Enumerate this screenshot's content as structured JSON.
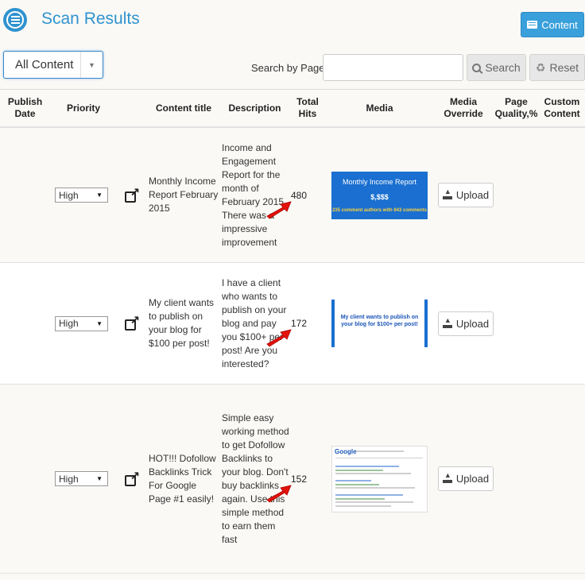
{
  "header": {
    "title": "Scan Results",
    "content_button": "Content"
  },
  "filters": {
    "content_select": "All Content",
    "search_label": "Search by Page",
    "search_value": "",
    "search_button": "Search",
    "reset_button": "Reset"
  },
  "table": {
    "headers": {
      "publish_date": "Publish Date",
      "priority": "Priority",
      "content_title": "Content title",
      "description": "Description",
      "total_hits": "Total Hits",
      "media": "Media",
      "media_override": "Media Override",
      "page_quality": "Page Quality,%",
      "custom_content": "Custom Content"
    },
    "upload_label": "Upload",
    "rows": [
      {
        "publish_date": "",
        "priority": "High",
        "title": "Monthly Income Report February 2015",
        "description": "Income and Engagement Report for the month of February 2015. There was a impressive improvement",
        "hits": "480",
        "media": {
          "line1": "Monthly Income Report",
          "line2": "$,$$$",
          "line3": "235 comment authors with 643 comments"
        }
      },
      {
        "publish_date": "",
        "priority": "High",
        "title": "My client wants to publish on your blog for $100 per post!",
        "description": "I have a client who wants to publish on your blog and pay you $100+ per post! Are you interested?",
        "hits": "172",
        "media": {
          "line1": "My client wants to publish on your blog for $100+ per post!"
        }
      },
      {
        "publish_date": "",
        "priority": "High",
        "title": "HOT!!! Dofollow Backlinks Trick For Google Page #1 easily!",
        "description": "Simple easy working method to get Dofollow Backlinks to your blog. Don't buy backlinks again. Use this simple method to earn them fast",
        "hits": "152",
        "media": {
          "line1": "Google"
        }
      }
    ]
  },
  "colors": {
    "accent": "#2f93cf",
    "button_blue": "#3aa0db",
    "arrow_red": "#e3120b"
  },
  "icons": [
    "menu-circle-icon",
    "list-icon",
    "search-icon",
    "recycle-icon",
    "external-link-icon",
    "upload-icon",
    "red-arrow-icon"
  ]
}
